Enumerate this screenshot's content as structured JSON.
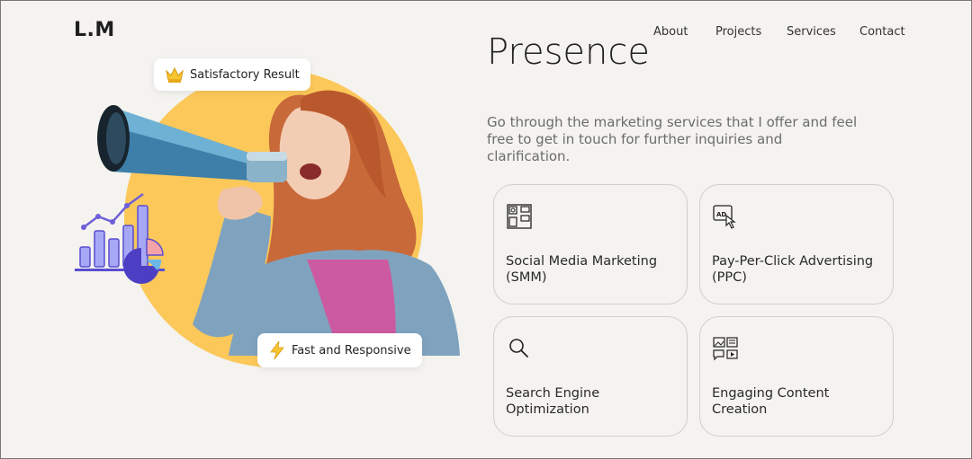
{
  "header": {
    "logo": "L.M",
    "nav": [
      "About",
      "Projects",
      "Services",
      "Contact"
    ]
  },
  "hero": {
    "title": "Presence",
    "description": "Go through the marketing services that I offer and feel free to get in touch for further inquiries and clarification."
  },
  "badges": {
    "top": "Satisfactory Result",
    "bottom": "Fast and Responsive"
  },
  "services": [
    {
      "label": "Social Media Marketing (SMM)",
      "icon": "social-media-icon"
    },
    {
      "label": "Pay-Per-Click Advertising (PPC)",
      "icon": "ad-click-icon"
    },
    {
      "label": "Search Engine Optimization",
      "icon": "search-icon"
    },
    {
      "label": "Engaging Content Creation",
      "icon": "content-creation-icon"
    }
  ],
  "colors": {
    "background": "#f4f3ef",
    "sun_circle": "#fcc85a",
    "chart_purple": "#6d5fd8"
  }
}
